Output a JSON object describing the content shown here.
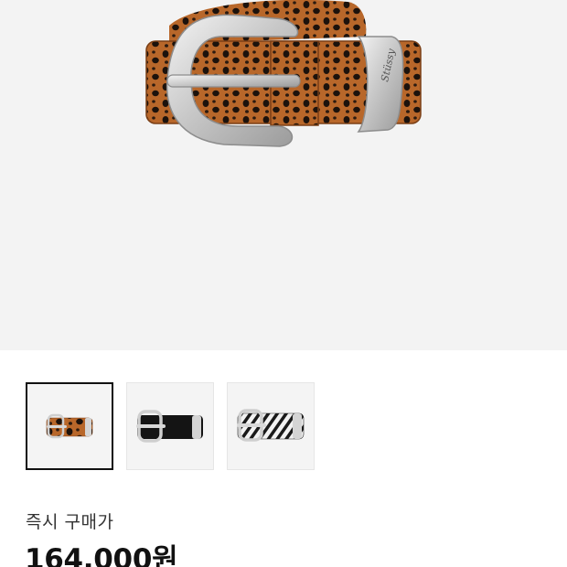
{
  "product": {
    "image_alt": "leopard print leather belt with silver buckle",
    "selected_thumbnail": 0,
    "thumbnails": [
      {
        "variant": "leopard",
        "selected": true
      },
      {
        "variant": "black",
        "selected": false
      },
      {
        "variant": "zebra",
        "selected": false
      }
    ]
  },
  "purchase": {
    "label": "즉시 구매가",
    "price": "164,000원"
  },
  "colors": {
    "hero_background": "#f3f3f3",
    "thumb_border_selected": "#111111",
    "price_text": "#111111"
  }
}
